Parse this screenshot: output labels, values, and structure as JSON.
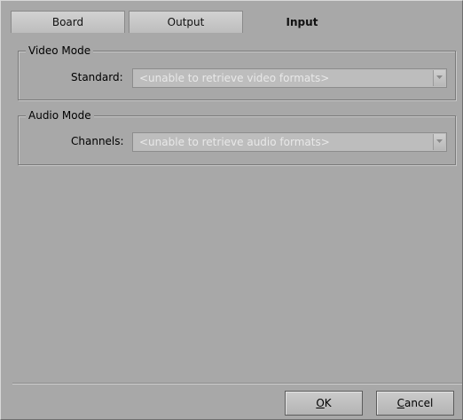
{
  "tabs": [
    {
      "label": "Board",
      "active": false
    },
    {
      "label": "Output",
      "active": false
    },
    {
      "label": "Input",
      "active": true
    }
  ],
  "video_mode": {
    "title": "Video Mode",
    "standard_label": "Standard:",
    "standard_value": "<unable to retrieve video formats>"
  },
  "audio_mode": {
    "title": "Audio Mode",
    "channels_label": "Channels:",
    "channels_value": "<unable to retrieve audio formats>"
  },
  "buttons": {
    "ok_label": "OK",
    "ok_mnemonic": "O",
    "ok_rest": "K",
    "cancel_label": "Cancel",
    "cancel_mnemonic": "C",
    "cancel_rest": "ancel"
  },
  "colors": {
    "dialog_bg": "#a8a8a8",
    "disabled_text": "#e8e8e8"
  },
  "icons": {
    "combo_arrow": "chevron-down-icon"
  }
}
